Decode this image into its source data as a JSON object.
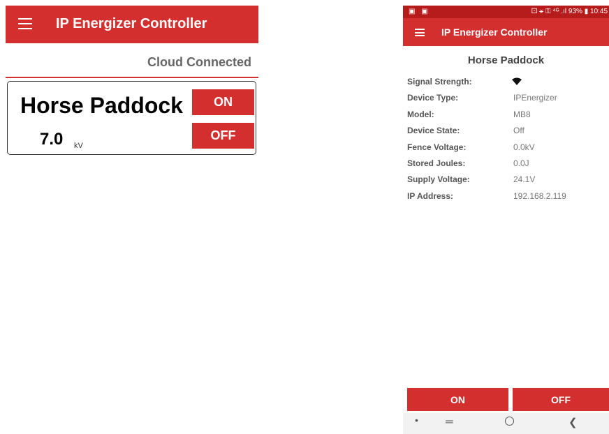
{
  "left": {
    "app_title": "IP Energizer Controller",
    "cloud_status": "Cloud Connected",
    "device_card": {
      "name": "Horse Paddock",
      "voltage": "7.0",
      "unit": "kV",
      "on_label": "ON",
      "off_label": "OFF"
    }
  },
  "right": {
    "status_bar": {
      "left_icons": "▣ ▣",
      "right_text": "⚀ ⚹ ⚿ ⁴ᴳ .ıl 93% ▮ 10:45"
    },
    "app_title": "IP Energizer Controller",
    "detail_title": "Horse Paddock",
    "details": [
      {
        "label": "Signal Strength:",
        "value": "",
        "icon": "wifi-signal-icon"
      },
      {
        "label": "Device Type:",
        "value": "IPEnergizer"
      },
      {
        "label": "Model:",
        "value": "MB8"
      },
      {
        "label": "Device State:",
        "value": "Off"
      },
      {
        "label": "Fence Voltage:",
        "value": "0.0kV"
      },
      {
        "label": "Stored Joules:",
        "value": "0.0J"
      },
      {
        "label": "Supply Voltage:",
        "value": "24.1V"
      },
      {
        "label": "IP Address:",
        "value": "192.168.2.119"
      }
    ],
    "on_label": "ON",
    "off_label": "OFF",
    "nav": {
      "dot": "•",
      "recent": "═",
      "back": "❮"
    }
  },
  "colors": {
    "accent_red": "#d32f2f",
    "status_bar_red": "#b71c1c"
  }
}
